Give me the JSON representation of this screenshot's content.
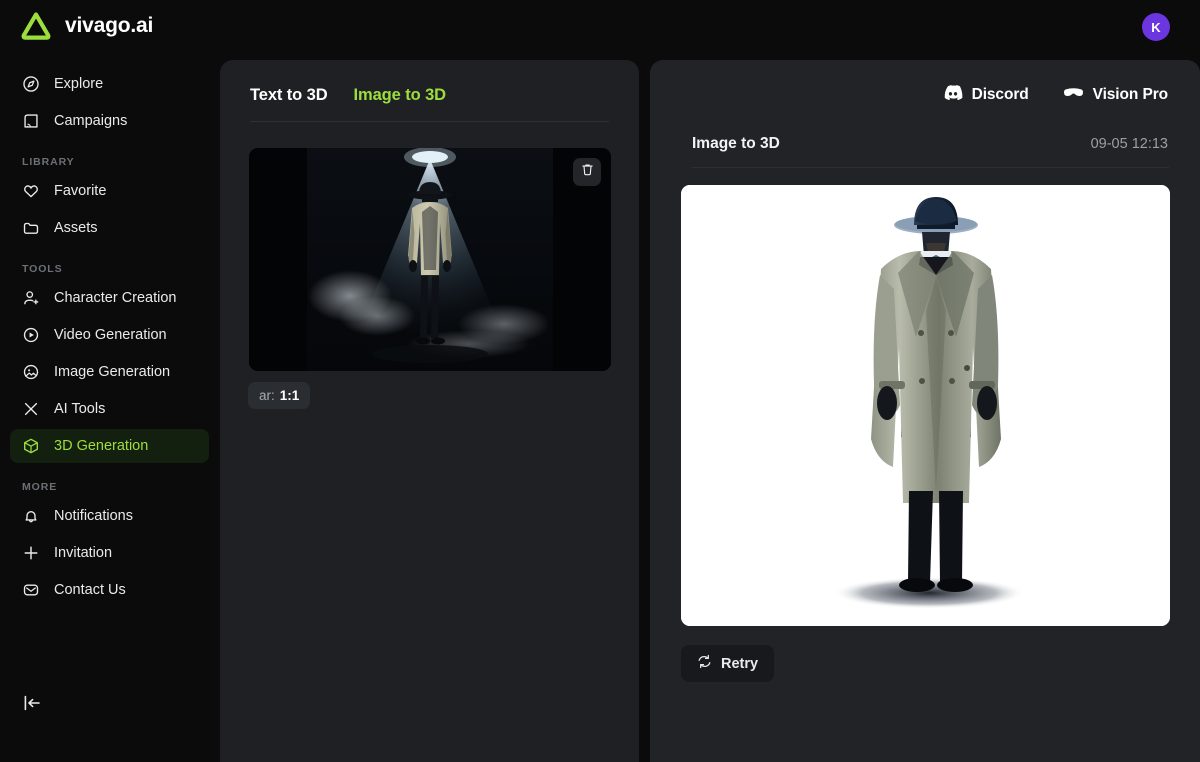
{
  "app": {
    "brand_name": "vivago.ai",
    "logo_icon": "triangle-logo-icon",
    "accent_color": "#9ede3c",
    "avatar_initial": "K",
    "avatar_color": "#6b36e0"
  },
  "sidebar": {
    "primary": [
      {
        "label": "Explore",
        "icon": "compass-icon",
        "active": false
      },
      {
        "label": "Campaigns",
        "icon": "campaign-icon",
        "active": false
      }
    ],
    "library_label": "LIBRARY",
    "library": [
      {
        "label": "Favorite",
        "icon": "heart-icon",
        "active": false
      },
      {
        "label": "Assets",
        "icon": "folder-icon",
        "active": false
      }
    ],
    "tools_label": "TOOLS",
    "tools": [
      {
        "label": "Character Creation",
        "icon": "person-add-icon",
        "active": false
      },
      {
        "label": "Video Generation",
        "icon": "play-circle-icon",
        "active": false
      },
      {
        "label": "Image Generation",
        "icon": "image-circle-icon",
        "active": false
      },
      {
        "label": "AI Tools",
        "icon": "scissors-icon",
        "active": false
      },
      {
        "label": "3D Generation",
        "icon": "cube-icon",
        "active": true
      }
    ],
    "more_label": "MORE",
    "more": [
      {
        "label": "Notifications",
        "icon": "bell-icon",
        "active": false
      },
      {
        "label": "Invitation",
        "icon": "plus-icon",
        "active": false
      },
      {
        "label": "Contact Us",
        "icon": "mail-icon",
        "active": false
      }
    ],
    "collapse_icon": "collapse-sidebar-icon"
  },
  "mid_panel": {
    "tabs": [
      {
        "label": "Text to 3D",
        "active": false
      },
      {
        "label": "Image to 3D",
        "active": true
      }
    ],
    "upload": {
      "trash_icon": "trash-icon",
      "image_alt": "detective-in-spotlight-dark-scene"
    },
    "aspect_ratio": {
      "key": "ar:",
      "value": "1:1"
    }
  },
  "right_panel": {
    "links": [
      {
        "label": "Discord",
        "icon": "discord-icon"
      },
      {
        "label": "Vision Pro",
        "icon": "vision-pro-icon"
      }
    ],
    "job_title": "Image to 3D",
    "timestamp": "09-05 12:13",
    "result_image_alt": "detective-in-trench-coat-on-white-background",
    "retry": {
      "label": "Retry",
      "icon": "refresh-icon"
    }
  }
}
